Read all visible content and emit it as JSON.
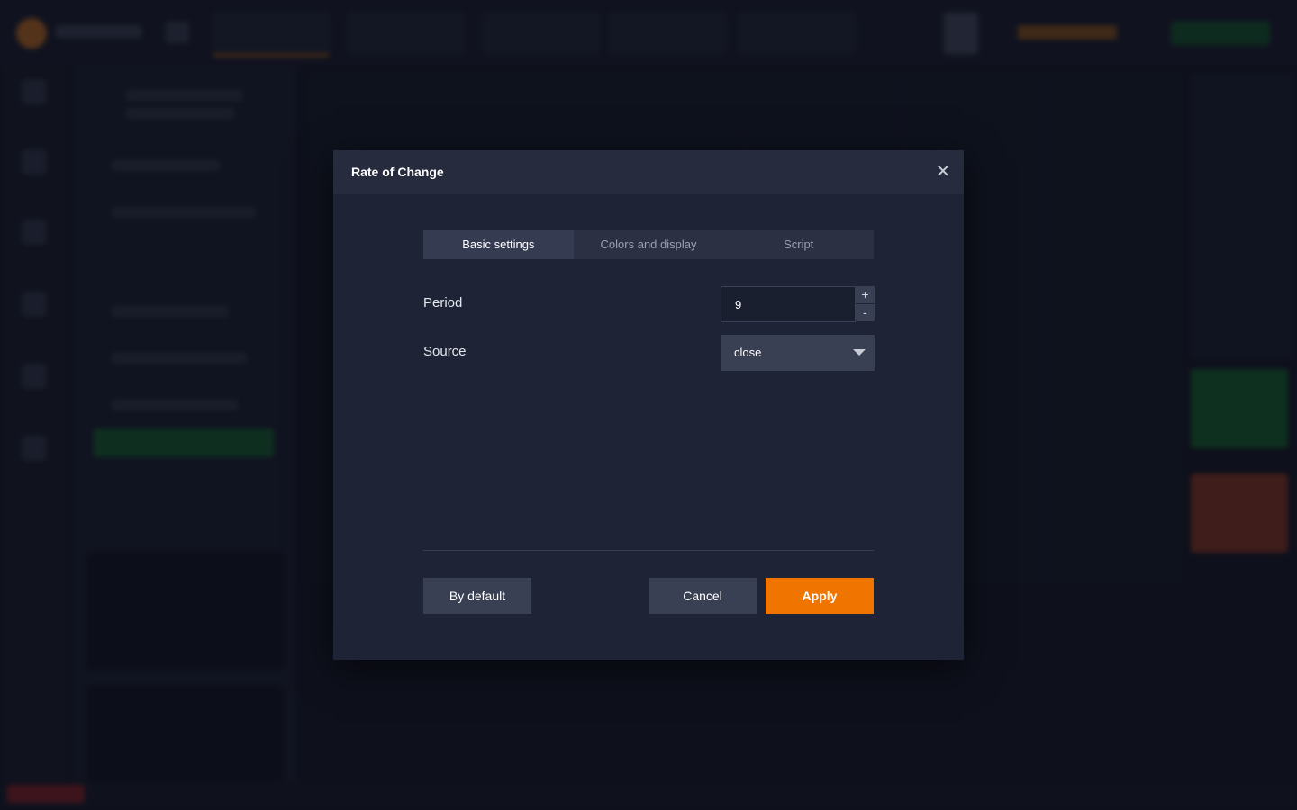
{
  "dialog": {
    "title": "Rate of Change",
    "close_icon": "close-icon",
    "tabs": [
      {
        "label": "Basic settings",
        "active": true
      },
      {
        "label": "Colors and display",
        "active": false
      },
      {
        "label": "Script",
        "active": false
      }
    ],
    "fields": {
      "period": {
        "label": "Period",
        "value": "9",
        "increment": "+",
        "decrement": "-"
      },
      "source": {
        "label": "Source",
        "value": "close"
      }
    },
    "buttons": {
      "default": "By default",
      "cancel": "Cancel",
      "apply": "Apply"
    }
  },
  "colors": {
    "accent": "#f07400",
    "dialog_bg": "#1e2436",
    "header_bg": "#262c3e",
    "button_bg": "#3a4053"
  }
}
